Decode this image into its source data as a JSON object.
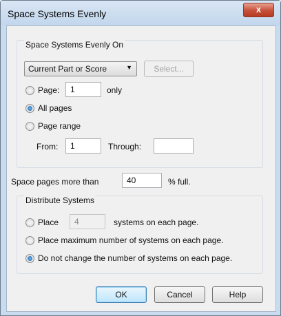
{
  "window": {
    "title": "Space Systems Evenly",
    "close_glyph": "x"
  },
  "space_on": {
    "group_label": "Space Systems Evenly On",
    "dropdown_value": "Current Part or Score",
    "select_button": "Select...",
    "page_option": "Page:",
    "page_value": "1",
    "page_suffix": "only",
    "all_pages_option": "All pages",
    "page_range_option": "Page range",
    "from_label": "From:",
    "from_value": "1",
    "through_label": "Through:",
    "through_value": "",
    "selected_option": "All pages"
  },
  "fill": {
    "label": "Space pages more than",
    "value": "40",
    "suffix": "% full."
  },
  "distribute": {
    "group_label": "Distribute Systems",
    "place_option": "Place",
    "place_value": "4",
    "place_suffix": "systems on each page.",
    "max_option": "Place maximum number of systems on each page.",
    "no_change_option": "Do not change the number of systems on each page.",
    "selected_option": "Do not change the number of systems on each page."
  },
  "buttons": {
    "ok": "OK",
    "cancel": "Cancel",
    "help": "Help"
  },
  "colors": {
    "title_bar": "#c9dbef",
    "close_button": "#c6503a",
    "radio_selected": "#1b5fa8"
  },
  "icons": {
    "close": "close-icon",
    "dropdown": "chevron-down-icon"
  }
}
